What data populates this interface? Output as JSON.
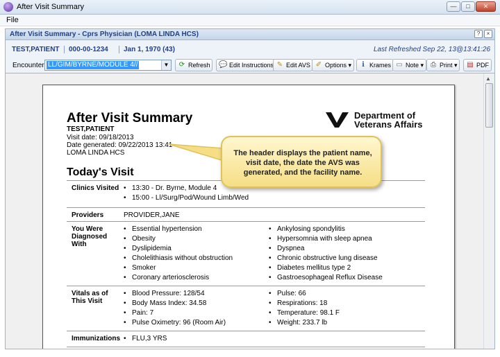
{
  "window": {
    "title": "After Visit Summary",
    "buttons": [
      "—",
      "□",
      "✕"
    ]
  },
  "menubar": {
    "file": "File"
  },
  "panel": {
    "title": "After Visit Summary - Cprs Physician (LOMA LINDA HCS)",
    "help": "?",
    "close": "×"
  },
  "patient_bar": {
    "name": "TEST,PATIENT",
    "ssn": "000-00-1234",
    "dob": "Jan 1, 1970 (43)",
    "last_refreshed": "Last Refreshed Sep 22, 13@13:41:26"
  },
  "toolbar": {
    "encounter_label": "Encounter:",
    "encounter_value": "LL/GIM/BYRNE/MODULE 4//",
    "refresh": "Refresh",
    "edit_instructions": "Edit Instructions",
    "edit_avs": "Edit AVS",
    "options": "Options",
    "krames": "Krames",
    "note": "Note",
    "print": "Print",
    "pdf": "PDF"
  },
  "document": {
    "title": "After Visit Summary",
    "patient": "TEST,PATIENT",
    "visit_date": "Visit date: 09/18/2013",
    "date_generated": "Date generated: 09/22/2013 13:41",
    "facility": "LOMA LINDA HCS",
    "logo_line1": "Department of",
    "logo_line2": "Veterans Affairs",
    "section_title": "Today's Visit",
    "clinics_label": "Clinics Visited",
    "clinics": [
      "13:30 - Dr. Byrne, Module 4",
      "15:00 - Ll/Surg/Pod/Wound Limb/Wed"
    ],
    "providers_label": "Providers",
    "providers": "PROVIDER,JANE",
    "diagnosed_label": "You Were Diagnosed With",
    "diagnoses_left": [
      "Essential hypertension",
      "Obesity",
      "Dyslipidemia",
      "Cholelithiasis without obstruction",
      "Smoker",
      "Coronary arteriosclerosis"
    ],
    "diagnoses_right": [
      "Ankylosing spondylitis",
      "Hypersomnia with sleep apnea",
      "Dyspnea",
      "Chronic obstructive lung disease",
      "Diabetes mellitus type 2",
      "Gastroesophageal Reflux Disease"
    ],
    "vitals_label": "Vitals as of This Visit",
    "vitals_left": [
      "Blood Pressure: 128/54",
      "Body Mass Index: 34.58",
      "Pain: 7",
      "Pulse Oximetry: 96 (Room Air)"
    ],
    "vitals_right": [
      "Pulse: 66",
      "Respirations: 18",
      "Temperature: 98.1 F",
      "Weight: 233.7 lb"
    ],
    "immunizations_label": "Immunizations",
    "immunizations": [
      "FLU,3 YRS"
    ]
  },
  "callout": {
    "text": "The header displays the patient name, visit date, the date the AVS was generated, and the facility name."
  },
  "colors": {
    "accent": "#1f3f8a",
    "callout": "#f6de86",
    "selection": "#3399ff"
  }
}
